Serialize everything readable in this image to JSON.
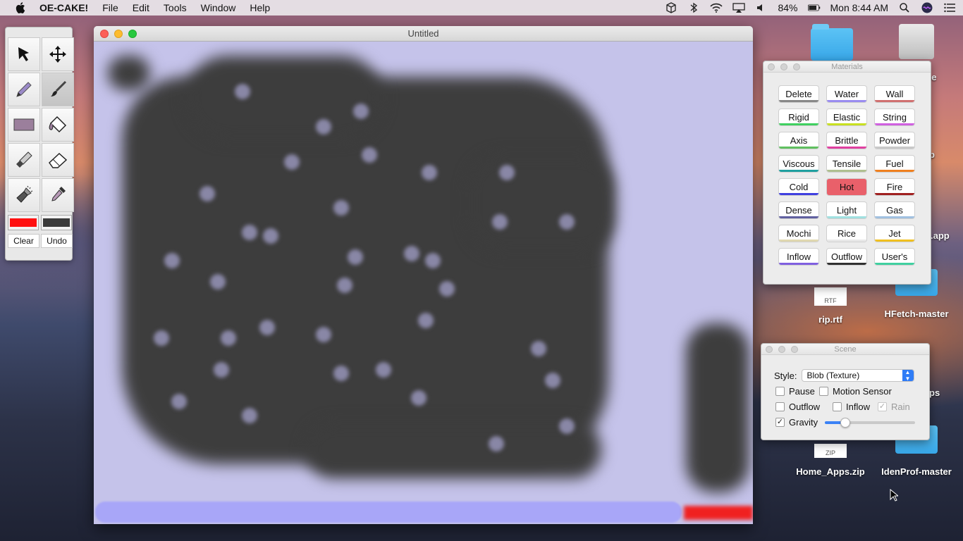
{
  "menubar": {
    "app_name": "OE-CAKE!",
    "menus": [
      "File",
      "Edit",
      "Tools",
      "Window",
      "Help"
    ],
    "battery": "84%",
    "clock": "Mon 8:44 AM"
  },
  "desktop": {
    "items": [
      {
        "label": "",
        "kind": "folder"
      },
      {
        "label": "ce",
        "kind": "drive"
      },
      {
        "label": "p",
        "kind": "app"
      },
      {
        "label": ".app",
        "kind": "app"
      },
      {
        "label": "rip.rtf",
        "kind": "doc",
        "doc_type": "RTF"
      },
      {
        "label": "HFetch-master",
        "kind": "folder"
      },
      {
        "label": "ps",
        "kind": "folder"
      },
      {
        "label": "Home_Apps.zip",
        "kind": "doc",
        "doc_type": "ZIP"
      },
      {
        "label": "IdenProf-master",
        "kind": "folder"
      }
    ]
  },
  "tools": {
    "items": [
      "select-arrow-icon",
      "move-icon",
      "pencil-icon",
      "brush-icon",
      "rectangle-icon",
      "fill-bucket-icon",
      "knife-icon",
      "eraser-icon",
      "flashlight-icon",
      "eyedropper-icon"
    ],
    "active": "brush-icon",
    "primary_color": "#ff1010",
    "secondary_color": "#3a3a3a",
    "clear_label": "Clear",
    "undo_label": "Undo"
  },
  "main_window": {
    "title": "Untitled",
    "canvas_bg": "#c5c3ea"
  },
  "materials": {
    "title": "Materials",
    "buttons": [
      {
        "label": "Delete",
        "color": "#888888"
      },
      {
        "label": "Water",
        "color": "#9a8cf0"
      },
      {
        "label": "Wall",
        "color": "#d07070"
      },
      {
        "label": "Rigid",
        "color": "#40d060"
      },
      {
        "label": "Elastic",
        "color": "#c8e020"
      },
      {
        "label": "String",
        "color": "#d060e0"
      },
      {
        "label": "Axis",
        "color": "#60c060"
      },
      {
        "label": "Brittle",
        "color": "#e040a0"
      },
      {
        "label": "Powder",
        "color": "#c8c8c8"
      },
      {
        "label": "Viscous",
        "color": "#20a0a0"
      },
      {
        "label": "Tensile",
        "color": "#b0c090"
      },
      {
        "label": "Fuel",
        "color": "#f08020"
      },
      {
        "label": "Cold",
        "color": "#4040e0"
      },
      {
        "label": "Hot",
        "color": "#e9606a"
      },
      {
        "label": "Fire",
        "color": "#a02020"
      },
      {
        "label": "Dense",
        "color": "#6060a0"
      },
      {
        "label": "Light",
        "color": "#a0e0e0"
      },
      {
        "label": "Gas",
        "color": "#a0c0e0"
      },
      {
        "label": "Mochi",
        "color": "#e0d8b0"
      },
      {
        "label": "Rice",
        "color": "#e8e8e8"
      },
      {
        "label": "Jet",
        "color": "#f0c020"
      },
      {
        "label": "Inflow",
        "color": "#8060e0"
      },
      {
        "label": "Outflow",
        "color": "#303030"
      },
      {
        "label": "User's",
        "color": "#40d0a0"
      }
    ],
    "selected": "Hot"
  },
  "scene": {
    "title": "Scene",
    "style_label": "Style:",
    "style_value": "Blob (Texture)",
    "pause_label": "Pause",
    "pause_checked": false,
    "motion_label": "Motion Sensor",
    "motion_checked": false,
    "outflow_label": "Outflow",
    "outflow_checked": false,
    "inflow_label": "Inflow",
    "inflow_checked": false,
    "rain_label": "Rain",
    "rain_checked": true,
    "gravity_label": "Gravity",
    "gravity_checked": true,
    "gravity_level": 0.23
  }
}
